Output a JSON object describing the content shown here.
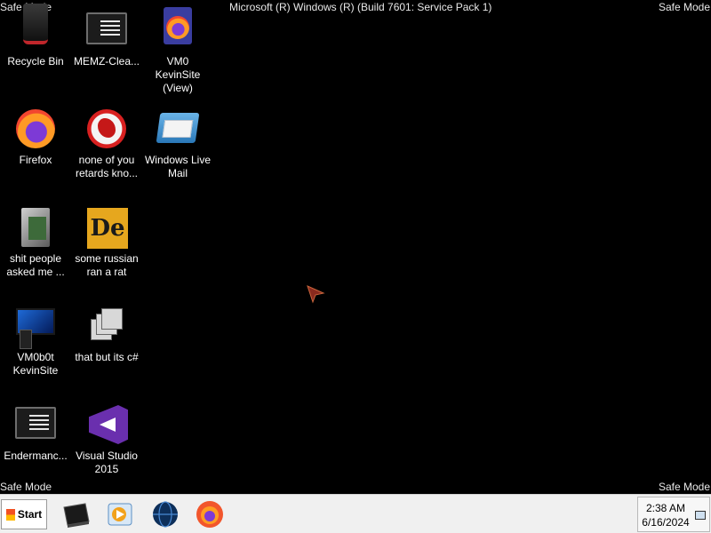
{
  "overlay": {
    "safe_mode_tl": "Safe Mode",
    "safe_mode_tr": "Safe Mode",
    "safe_mode_bl": "Safe Mode",
    "safe_mode_br": "Safe Mode",
    "build": "Microsoft (R) Windows (R) (Build 7601: Service Pack 1)"
  },
  "desktop": {
    "icons": [
      {
        "label": "Recycle Bin",
        "icon": "recycle-bin-icon"
      },
      {
        "label": "MEMZ-Clea...",
        "icon": "terminal-icon"
      },
      {
        "label": "VM0 KevinSite (View)",
        "icon": "firefox-document-icon"
      },
      {
        "label": "Firefox",
        "icon": "firefox-icon"
      },
      {
        "label": "none of you retards kno...",
        "icon": "dragon-icon"
      },
      {
        "label": "Windows Live Mail",
        "icon": "mail-icon"
      },
      {
        "label": "shit people asked me ...",
        "icon": "folder-icon"
      },
      {
        "label": "some russian ran a rat",
        "icon": "de-icon"
      },
      {
        "label": "VM0b0t KevinSite",
        "icon": "computer-icon"
      },
      {
        "label": "that but its c#",
        "icon": "stacked-windows-icon"
      },
      {
        "label": "Endermanc...",
        "icon": "terminal-icon"
      },
      {
        "label": "Visual Studio 2015",
        "icon": "visual-studio-icon"
      }
    ]
  },
  "taskbar": {
    "start_label": "Start",
    "items": [
      "terminal-icon",
      "media-player-icon",
      "globe-icon",
      "firefox-icon"
    ],
    "clock_time": "2:38 AM",
    "clock_date": "6/16/2024"
  },
  "colors": {
    "desktop_bg": "#000000",
    "taskbar_bg": "#f0f0f0"
  }
}
